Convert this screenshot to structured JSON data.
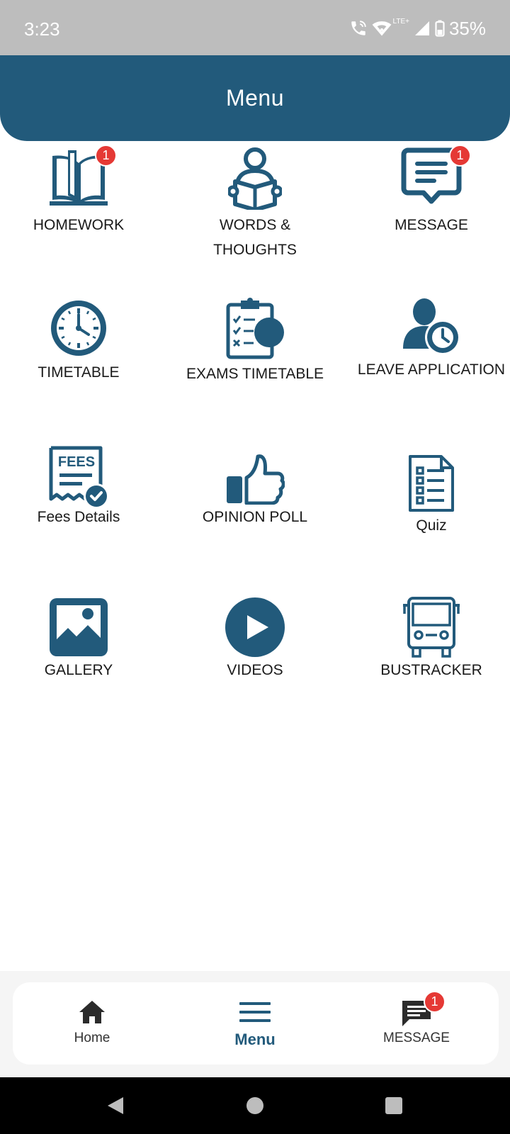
{
  "status_bar": {
    "time": "3:23",
    "network": "LTE+",
    "battery": "35%"
  },
  "header": {
    "title": "Menu"
  },
  "menu": {
    "items": [
      {
        "label": "HOMEWORK",
        "icon": "book-icon",
        "badge": "1"
      },
      {
        "label": "WORDS & THOUGHTS",
        "icon": "reading-person-icon"
      },
      {
        "label": "MESSAGE",
        "icon": "message-bubble-icon",
        "badge": "1"
      },
      {
        "label": "TIMETABLE",
        "icon": "clock-icon"
      },
      {
        "label": "EXAMS TIMETABLE",
        "icon": "clipboard-checklist-icon"
      },
      {
        "label": "LEAVE APPLICATION",
        "icon": "person-clock-icon"
      },
      {
        "label": "Fees Details",
        "icon": "fees-receipt-icon"
      },
      {
        "label": "OPINION POLL",
        "icon": "thumbs-up-icon"
      },
      {
        "label": "Quiz",
        "icon": "quiz-document-icon"
      },
      {
        "label": "GALLERY",
        "icon": "image-icon"
      },
      {
        "label": "VIDEOS",
        "icon": "play-circle-icon"
      },
      {
        "label": "BUSTRACKER",
        "icon": "bus-icon"
      }
    ]
  },
  "bottom_nav": {
    "items": [
      {
        "label": "Home",
        "icon": "home-icon"
      },
      {
        "label": "Menu",
        "icon": "hamburger-menu-icon",
        "active": true
      },
      {
        "label": "MESSAGE",
        "icon": "message-icon",
        "badge": "1"
      }
    ]
  },
  "colors": {
    "primary": "#225a7b",
    "badge": "#e53935",
    "status_bar": "#bdbdbd"
  }
}
